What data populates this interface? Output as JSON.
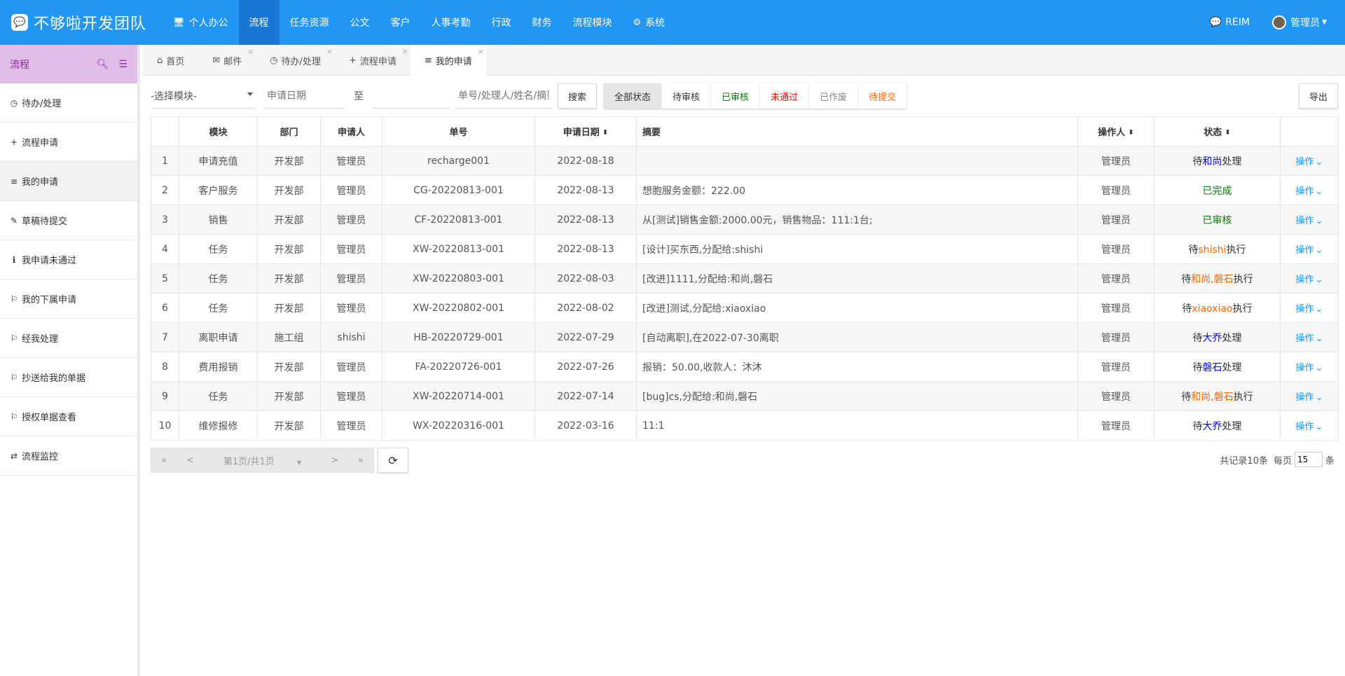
{
  "brand": {
    "title": "不够啦开发团队"
  },
  "nav": {
    "items": [
      {
        "icon": "🖥",
        "label": "个人办公"
      },
      {
        "icon": "",
        "label": "流程"
      },
      {
        "icon": "",
        "label": "任务资源"
      },
      {
        "icon": "",
        "label": "公文"
      },
      {
        "icon": "",
        "label": "客户"
      },
      {
        "icon": "",
        "label": "人事考勤"
      },
      {
        "icon": "",
        "label": "行政"
      },
      {
        "icon": "",
        "label": "财务"
      },
      {
        "icon": "",
        "label": "流程模块"
      },
      {
        "icon": "⚙",
        "label": "系统"
      }
    ],
    "active_index": 1,
    "reim_label": "REIM",
    "user_label": "管理员"
  },
  "sidebar": {
    "title": "流程",
    "items": [
      {
        "icon": "◷",
        "label": "待办/处理"
      },
      {
        "icon": "+",
        "label": "流程申请"
      },
      {
        "icon": "≡",
        "label": "我的申请"
      },
      {
        "icon": "✎",
        "label": "草稿待提交"
      },
      {
        "icon": "ℹ",
        "label": "我申请未通过"
      },
      {
        "icon": "⚐",
        "label": "我的下属申请"
      },
      {
        "icon": "⚐",
        "label": "经我处理"
      },
      {
        "icon": "⚐",
        "label": "抄送给我的单据"
      },
      {
        "icon": "⚐",
        "label": "授权单据查看"
      },
      {
        "icon": "⇄",
        "label": "流程监控"
      }
    ],
    "active_index": 2
  },
  "tabs": [
    {
      "icon": "⌂",
      "label": "首页",
      "closable": false
    },
    {
      "icon": "✉",
      "label": "邮件",
      "closable": true
    },
    {
      "icon": "◷",
      "label": "待办/处理",
      "closable": true
    },
    {
      "icon": "+",
      "label": "流程申请",
      "closable": true
    },
    {
      "icon": "≡",
      "label": "我的申请",
      "closable": true
    }
  ],
  "toolbar": {
    "module_select": "-选择模块-",
    "date_placeholder": "申请日期",
    "to_label": "至",
    "keyword_placeholder": "单号/处理人/姓名/摘要",
    "search_label": "搜索",
    "status_buttons": [
      {
        "label": "全部状态",
        "color": "#333333"
      },
      {
        "label": "待审核",
        "color": "#333333"
      },
      {
        "label": "已审核",
        "color": "#008000"
      },
      {
        "label": "未通过",
        "color": "#ff0000"
      },
      {
        "label": "已作废",
        "color": "#888888"
      },
      {
        "label": "待提交",
        "color": "#ff6600"
      }
    ],
    "export_label": "导出"
  },
  "table": {
    "headers": [
      "",
      "模块",
      "部门",
      "申请人",
      "单号",
      "申请日期",
      "摘要",
      "操作人",
      "状态",
      ""
    ],
    "rows": [
      {
        "no": "1",
        "module": "申请充值",
        "dept": "开发部",
        "applicant": "管理员",
        "code": "recharge001",
        "date": "2022-08-18",
        "summary": "",
        "operator": "管理员",
        "status": [
          {
            "t": "待",
            "c": "#333333"
          },
          {
            "t": "和尚",
            "c": "#0000ff"
          },
          {
            "t": "处理",
            "c": "#333333"
          }
        ]
      },
      {
        "no": "2",
        "module": "客户服务",
        "dept": "开发部",
        "applicant": "管理员",
        "code": "CG-20220813-001",
        "date": "2022-08-13",
        "summary": "想胞服务金额：222.00",
        "operator": "管理员",
        "status": [
          {
            "t": "已完成",
            "c": "#008000"
          }
        ]
      },
      {
        "no": "3",
        "module": "销售",
        "dept": "开发部",
        "applicant": "管理员",
        "code": "CF-20220813-001",
        "date": "2022-08-13",
        "summary": "从[测试]销售金额:2000.00元，销售物品：111:1台;",
        "operator": "管理员",
        "status": [
          {
            "t": "已审核",
            "c": "#008000"
          }
        ]
      },
      {
        "no": "4",
        "module": "任务",
        "dept": "开发部",
        "applicant": "管理员",
        "code": "XW-20220813-001",
        "date": "2022-08-13",
        "summary": "[设计]买东西,分配给:shishi",
        "operator": "管理员",
        "status": [
          {
            "t": "待",
            "c": "#333333"
          },
          {
            "t": "shishi",
            "c": "#ff6600"
          },
          {
            "t": "执行",
            "c": "#333333"
          }
        ]
      },
      {
        "no": "5",
        "module": "任务",
        "dept": "开发部",
        "applicant": "管理员",
        "code": "XW-20220803-001",
        "date": "2022-08-03",
        "summary": "[改进]1111,分配给:和尚,磐石",
        "operator": "管理员",
        "status": [
          {
            "t": "待",
            "c": "#333333"
          },
          {
            "t": "和尚,磐石",
            "c": "#ff6600"
          },
          {
            "t": "执行",
            "c": "#333333"
          }
        ]
      },
      {
        "no": "6",
        "module": "任务",
        "dept": "开发部",
        "applicant": "管理员",
        "code": "XW-20220802-001",
        "date": "2022-08-02",
        "summary": "[改进]测试,分配给:xiaoxiao",
        "operator": "管理员",
        "status": [
          {
            "t": "待",
            "c": "#333333"
          },
          {
            "t": "xiaoxiao",
            "c": "#ff6600"
          },
          {
            "t": "执行",
            "c": "#333333"
          }
        ]
      },
      {
        "no": "7",
        "module": "离职申请",
        "dept": "施工组",
        "applicant": "shishi",
        "code": "HB-20220729-001",
        "date": "2022-07-29",
        "summary": "[自动离职],在2022-07-30离职",
        "operator": "管理员",
        "status": [
          {
            "t": "待",
            "c": "#333333"
          },
          {
            "t": "大乔",
            "c": "#0000ff"
          },
          {
            "t": "处理",
            "c": "#333333"
          }
        ]
      },
      {
        "no": "8",
        "module": "费用报销",
        "dept": "开发部",
        "applicant": "管理员",
        "code": "FA-20220726-001",
        "date": "2022-07-26",
        "summary": "报销：50.00,收款人：沐沐",
        "operator": "管理员",
        "status": [
          {
            "t": "待",
            "c": "#333333"
          },
          {
            "t": "磐石",
            "c": "#0000ff"
          },
          {
            "t": "处理",
            "c": "#333333"
          }
        ]
      },
      {
        "no": "9",
        "module": "任务",
        "dept": "开发部",
        "applicant": "管理员",
        "code": "XW-20220714-001",
        "date": "2022-07-14",
        "summary": "[bug]cs,分配给:和尚,磐石",
        "operator": "管理员",
        "status": [
          {
            "t": "待",
            "c": "#333333"
          },
          {
            "t": "和尚,磐石",
            "c": "#ff6600"
          },
          {
            "t": "执行",
            "c": "#333333"
          }
        ]
      },
      {
        "no": "10",
        "module": "维修报修",
        "dept": "开发部",
        "applicant": "管理员",
        "code": "WX-20220316-001",
        "date": "2022-03-16",
        "summary": "11:1",
        "operator": "管理员",
        "status": [
          {
            "t": "待",
            "c": "#333333"
          },
          {
            "t": "大乔",
            "c": "#0000ff"
          },
          {
            "t": "处理",
            "c": "#333333"
          }
        ]
      }
    ],
    "action_label": "操作"
  },
  "pager": {
    "first": "«",
    "prev": "<",
    "page_info": "第1页/共1页",
    "next": ">",
    "last": "»",
    "total": "共记录10条",
    "per_page_label": "每页",
    "per_page_value": "15",
    "per_page_unit": "条"
  }
}
